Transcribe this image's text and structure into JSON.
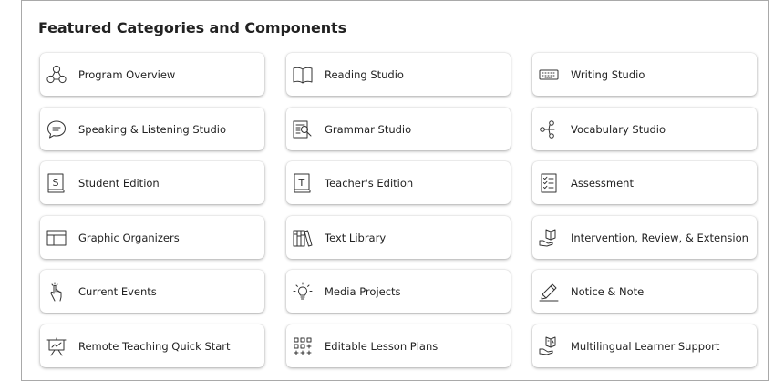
{
  "section": {
    "title": "Featured Categories and Components"
  },
  "cards": [
    {
      "label": "Program Overview",
      "icon": "network-nodes-icon"
    },
    {
      "label": "Reading Studio",
      "icon": "open-book-icon"
    },
    {
      "label": "Writing Studio",
      "icon": "keyboard-icon"
    },
    {
      "label": "Speaking & Listening Studio",
      "icon": "speech-bubble-icon"
    },
    {
      "label": "Grammar Studio",
      "icon": "document-magnifier-icon"
    },
    {
      "label": "Vocabulary Studio",
      "icon": "word-map-icon"
    },
    {
      "label": "Student Edition",
      "icon": "student-book-icon"
    },
    {
      "label": "Teacher's Edition",
      "icon": "teacher-book-icon"
    },
    {
      "label": "Assessment",
      "icon": "checklist-icon"
    },
    {
      "label": "Graphic Organizers",
      "icon": "layout-grid-icon"
    },
    {
      "label": "Text Library",
      "icon": "bookshelf-icon"
    },
    {
      "label": "Intervention, Review, & Extension",
      "icon": "hand-book-icon"
    },
    {
      "label": "Current Events",
      "icon": "tap-gesture-icon"
    },
    {
      "label": "Media Projects",
      "icon": "lightbulb-icon"
    },
    {
      "label": "Notice & Note",
      "icon": "pencil-icon"
    },
    {
      "label": "Remote Teaching Quick Start",
      "icon": "presentation-easel-icon"
    },
    {
      "label": "Editable Lesson Plans",
      "icon": "editable-grid-icon"
    },
    {
      "label": "Multilingual Learner Support",
      "icon": "hand-language-icon"
    }
  ]
}
